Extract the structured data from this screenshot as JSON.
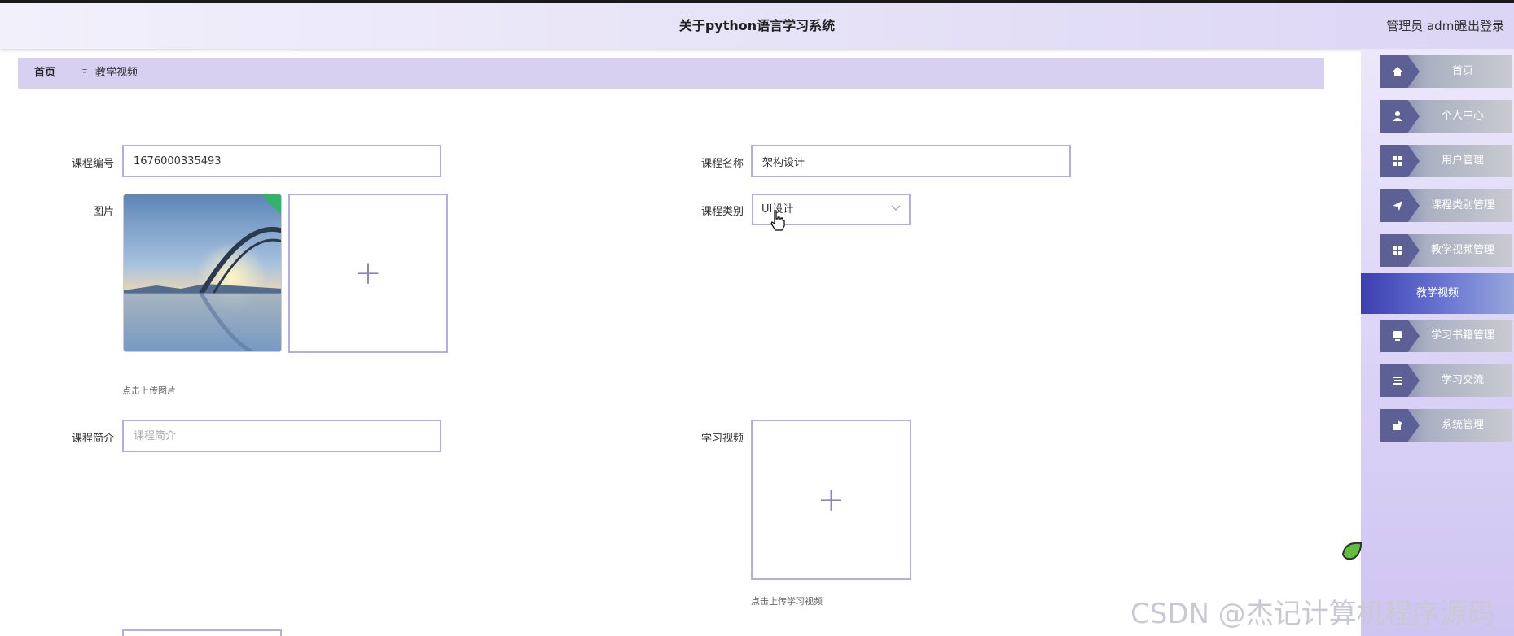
{
  "header": {
    "title": "关于python语言学习系统",
    "user": "管理员 admin",
    "logout": "退出登录"
  },
  "breadcrumb": {
    "home": "首页",
    "separator": "Ξ",
    "current": "教学视频"
  },
  "form": {
    "course_no_label": "课程编号",
    "course_no_value": "1676000335493",
    "course_name_label": "课程名称",
    "course_name_value": "架构设计",
    "image_label": "图片",
    "image_hint": "点击上传图片",
    "category_label": "课程类别",
    "category_value": "UI设计",
    "intro_label": "课程简介",
    "intro_placeholder": "课程简介",
    "video_label": "学习视频",
    "video_hint": "点击上传学习视频"
  },
  "sidebar": {
    "items": [
      {
        "label": "首页",
        "icon": "home-icon"
      },
      {
        "label": "个人中心",
        "icon": "user-icon"
      },
      {
        "label": "用户管理",
        "icon": "grid-icon"
      },
      {
        "label": "课程类别管理",
        "icon": "send-icon"
      },
      {
        "label": "教学视频管理",
        "icon": "grid-icon"
      },
      {
        "label": "教学视频",
        "icon": "",
        "active": true
      },
      {
        "label": "学习书籍管理",
        "icon": "book-icon"
      },
      {
        "label": "学习交流",
        "icon": "list-icon"
      },
      {
        "label": "系统管理",
        "icon": "settings-icon"
      }
    ]
  },
  "watermark": "CSDN @杰记计算机程序源码",
  "colors": {
    "accent": "#b4ace4",
    "header_bg": "#e7e3f7",
    "breadcrumb_bg": "#d7d0f1",
    "nav_active": "#3c3fb0"
  }
}
